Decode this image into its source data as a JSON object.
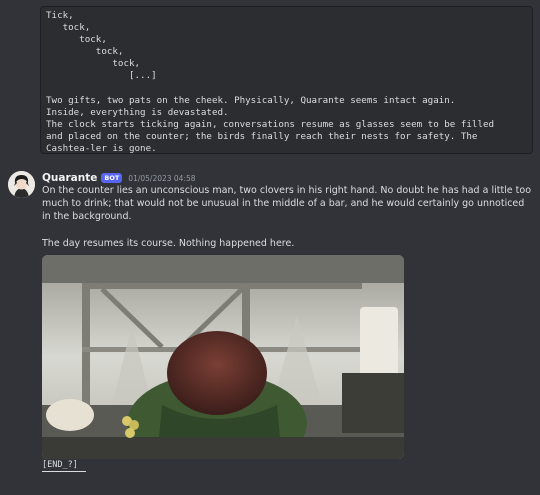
{
  "code_block": {
    "lines": [
      "Tick,",
      "   tock,",
      "      tock,",
      "         tock,",
      "            tock,",
      "               [...]",
      "",
      "Two gifts, two pats on the cheek. Physically, Quarante seems intact again.",
      "Inside, everything is devastated.",
      "The clock starts ticking again, conversations resume as glasses seem to be filled",
      "and placed on the counter; the birds finally reach their nests for safety. The",
      "Cashtea-ler is gone."
    ]
  },
  "message": {
    "author": "Quarante",
    "bot_tag": "BOT",
    "timestamp": "01/05/2023 04:58",
    "paragraph1": "On the counter lies an unconscious man, two clovers in his right hand. No doubt he has had a little too much to drink; that would not be unusual in the middle of a bar, and he would certainly go unnoticed in the background.",
    "paragraph2": "The day resumes its course. Nothing happened here.",
    "attachment_icon": "illustration-image",
    "spoiler_text": "[END_?]"
  },
  "colors": {
    "background": "#313338",
    "code_background": "#2b2d31",
    "bot_tag": "#5865f2",
    "author": "#f2f3f5",
    "timestamp": "#949ba4"
  }
}
